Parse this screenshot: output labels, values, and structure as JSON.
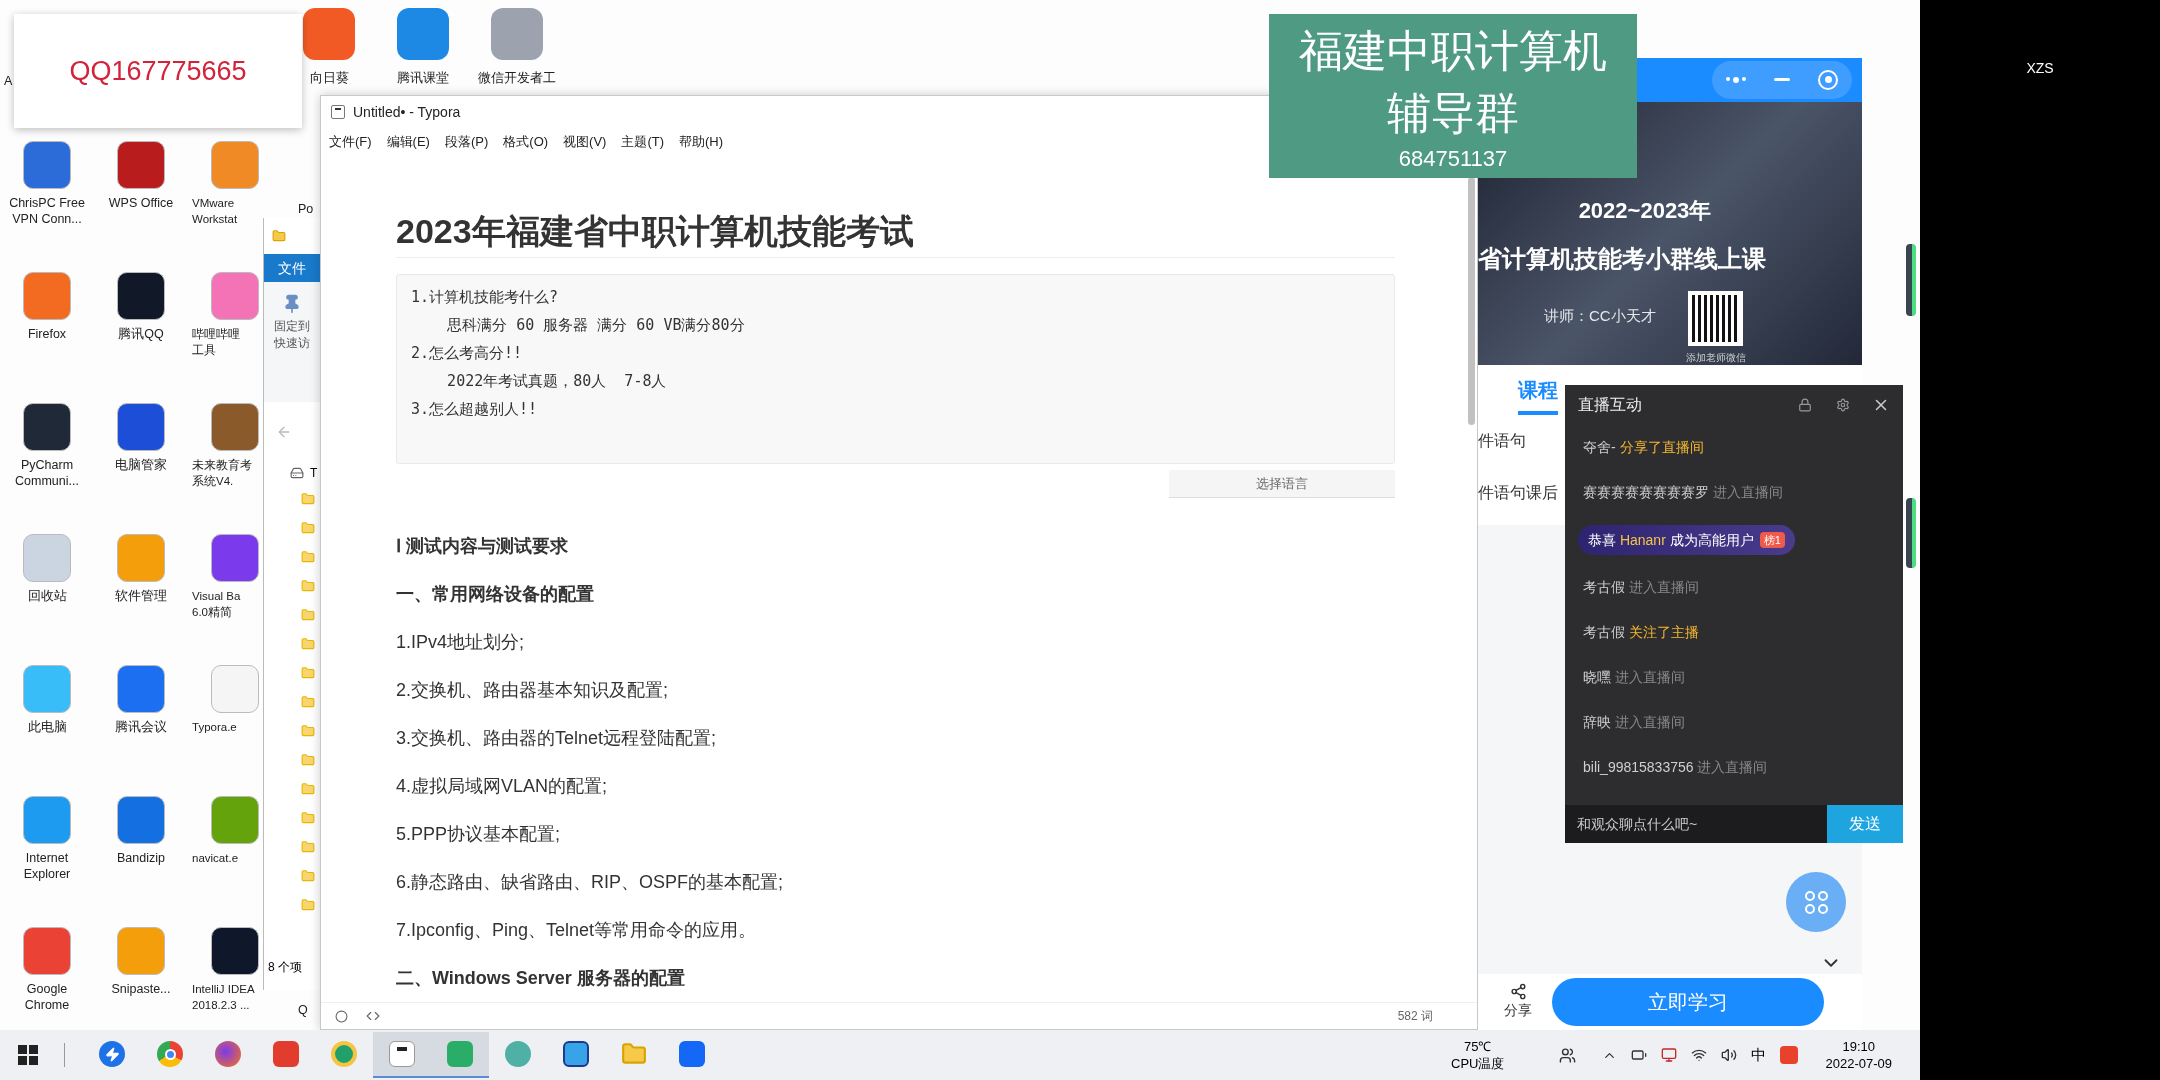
{
  "qq_banner": {
    "text": "QQ167775665"
  },
  "desktop": {
    "partial_label": "A",
    "top_icons": [
      {
        "lines": [
          "向日葵"
        ]
      },
      {
        "lines": [
          "腾讯课堂"
        ]
      },
      {
        "lines": [
          "微信开发者工"
        ]
      }
    ],
    "columns": [
      [
        {
          "lines": [
            "ChrisPC Free",
            "VPN Conn..."
          ]
        },
        {
          "lines": [
            "Firefox"
          ]
        },
        {
          "lines": [
            "PyCharm",
            "Communi..."
          ]
        },
        {
          "lines": [
            "回收站"
          ]
        },
        {
          "lines": [
            "此电脑"
          ]
        },
        {
          "lines": [
            "Internet",
            "Explorer"
          ]
        },
        {
          "lines": [
            "Google",
            "Chrome"
          ]
        }
      ],
      [
        {
          "lines": [
            "WPS Office"
          ]
        },
        {
          "lines": [
            "腾讯QQ"
          ]
        },
        {
          "lines": [
            "电脑管家"
          ]
        },
        {
          "lines": [
            "软件管理"
          ]
        },
        {
          "lines": [
            "腾讯会议"
          ]
        },
        {
          "lines": [
            "Bandizip"
          ]
        },
        {
          "lines": [
            "Snipaste..."
          ]
        }
      ],
      [
        {
          "lines": [
            "VMware",
            "Workstat"
          ]
        },
        {
          "lines": [
            "哔哩哔哩",
            "工具"
          ]
        },
        {
          "lines": [
            "未来教育考",
            "系统V4."
          ]
        },
        {
          "lines": [
            "Visual Ba",
            "6.0精简"
          ]
        },
        {
          "lines": [
            "Typora.e"
          ]
        },
        {
          "lines": [
            "navicat.e"
          ]
        },
        {
          "lines": [
            "IntelliJ IDEA",
            "2018.2.3 ..."
          ]
        }
      ]
    ],
    "edge_labels": [
      "Po",
      "Q"
    ]
  },
  "explorer": {
    "ribbon_tab": "文件",
    "pin_lines": [
      "固定到",
      "快速访"
    ],
    "drive_label": "T",
    "status": "8 个项"
  },
  "typora": {
    "title": "Untitled• - Typora",
    "menu": [
      "文件(F)",
      "编辑(E)",
      "段落(P)",
      "格式(O)",
      "视图(V)",
      "主题(T)",
      "帮助(H)"
    ],
    "heading": "2023年福建省中职计算机技能考试",
    "code_lines": [
      "1.计算机技能考什么?",
      "    思科满分 60 服务器 满分 60 VB满分80分",
      "2.怎么考高分!!",
      "    2022年考试真题，80人  7-8人",
      "3.怎么超越别人!!"
    ],
    "language_button": "选择语言",
    "blocks": [
      {
        "kind": "section",
        "text": "Ⅰ  测试内容与测试要求"
      },
      {
        "kind": "section",
        "text": "一、常用网络设备的配置"
      },
      {
        "kind": "item",
        "text": "1.IPv4地址划分;"
      },
      {
        "kind": "item",
        "text": "2.交换机、路由器基本知识及配置;"
      },
      {
        "kind": "item",
        "text": "3.交换机、路由器的Telnet远程登陆配置;"
      },
      {
        "kind": "item",
        "text": "4.虚拟局域网VLAN的配置;"
      },
      {
        "kind": "item",
        "text": "5.PPP协议基本配置;"
      },
      {
        "kind": "item",
        "text": "6.静态路由、缺省路由、RIP、OSPF的基本配置;"
      },
      {
        "kind": "item",
        "text": "7.Ipconfig、Ping、Telnet等常用命令的应用。"
      },
      {
        "kind": "section",
        "text": "二、Windows Server 服务器的配置"
      }
    ],
    "word_count": "582 词"
  },
  "group_banner": {
    "lines": [
      "福建中职计算机",
      "辅导群"
    ],
    "number": "684751137"
  },
  "course": {
    "banner_year": "2022~2023年",
    "banner_title": "省计算机技能考小群线上课",
    "teacher": "讲师：CC小天才",
    "qr_caption": "添加老师微信",
    "tabs": [
      {
        "label": "课程",
        "selected": true
      }
    ],
    "lines": [
      "件语句",
      "件语句课后"
    ],
    "share": "分享",
    "study_button": "立即学习"
  },
  "chat": {
    "title": "直播互动",
    "messages": [
      {
        "kind": "highlight",
        "user": "夺舍-",
        "action": "分享了直播间"
      },
      {
        "kind": "plain",
        "user": "赛赛赛赛赛赛赛赛罗",
        "action": "进入直播间"
      },
      {
        "kind": "congrats",
        "prefix": "恭喜",
        "user": "Hananr",
        "action": "成为高能用户",
        "badge": "榜1"
      },
      {
        "kind": "plain",
        "user": "考古假",
        "action": "进入直播间"
      },
      {
        "kind": "highlight",
        "user": "考古假",
        "action": "关注了主播"
      },
      {
        "kind": "plain",
        "user": "晓嘿",
        "action": "进入直播间"
      },
      {
        "kind": "plain",
        "user": "辞映",
        "action": "进入直播间"
      },
      {
        "kind": "plain",
        "user": "bili_99815833756",
        "action": "进入直播间"
      }
    ],
    "placeholder": "和观众聊点什么吧~",
    "send": "发送"
  },
  "side_panel": {
    "name": "XZS"
  },
  "taskbar": {
    "apps": [
      {
        "kind": "bolt",
        "selected": false
      },
      {
        "kind": "chrome",
        "selected": false
      },
      {
        "kind": "firefox",
        "selected": false
      },
      {
        "kind": "wps",
        "selected": false
      },
      {
        "kind": "k",
        "selected": false
      },
      {
        "kind": "typora",
        "selected": true
      },
      {
        "kind": "wechat",
        "selected": true
      },
      {
        "kind": "avatar",
        "selected": false
      },
      {
        "kind": "picture",
        "selected": false
      },
      {
        "kind": "folder",
        "selected": false
      },
      {
        "kind": "meeting",
        "selected": false
      }
    ],
    "temperature": "75℃",
    "temperature_label": "CPU温度",
    "ime": "中",
    "time": "19:10",
    "date": "2022-07-09"
  }
}
